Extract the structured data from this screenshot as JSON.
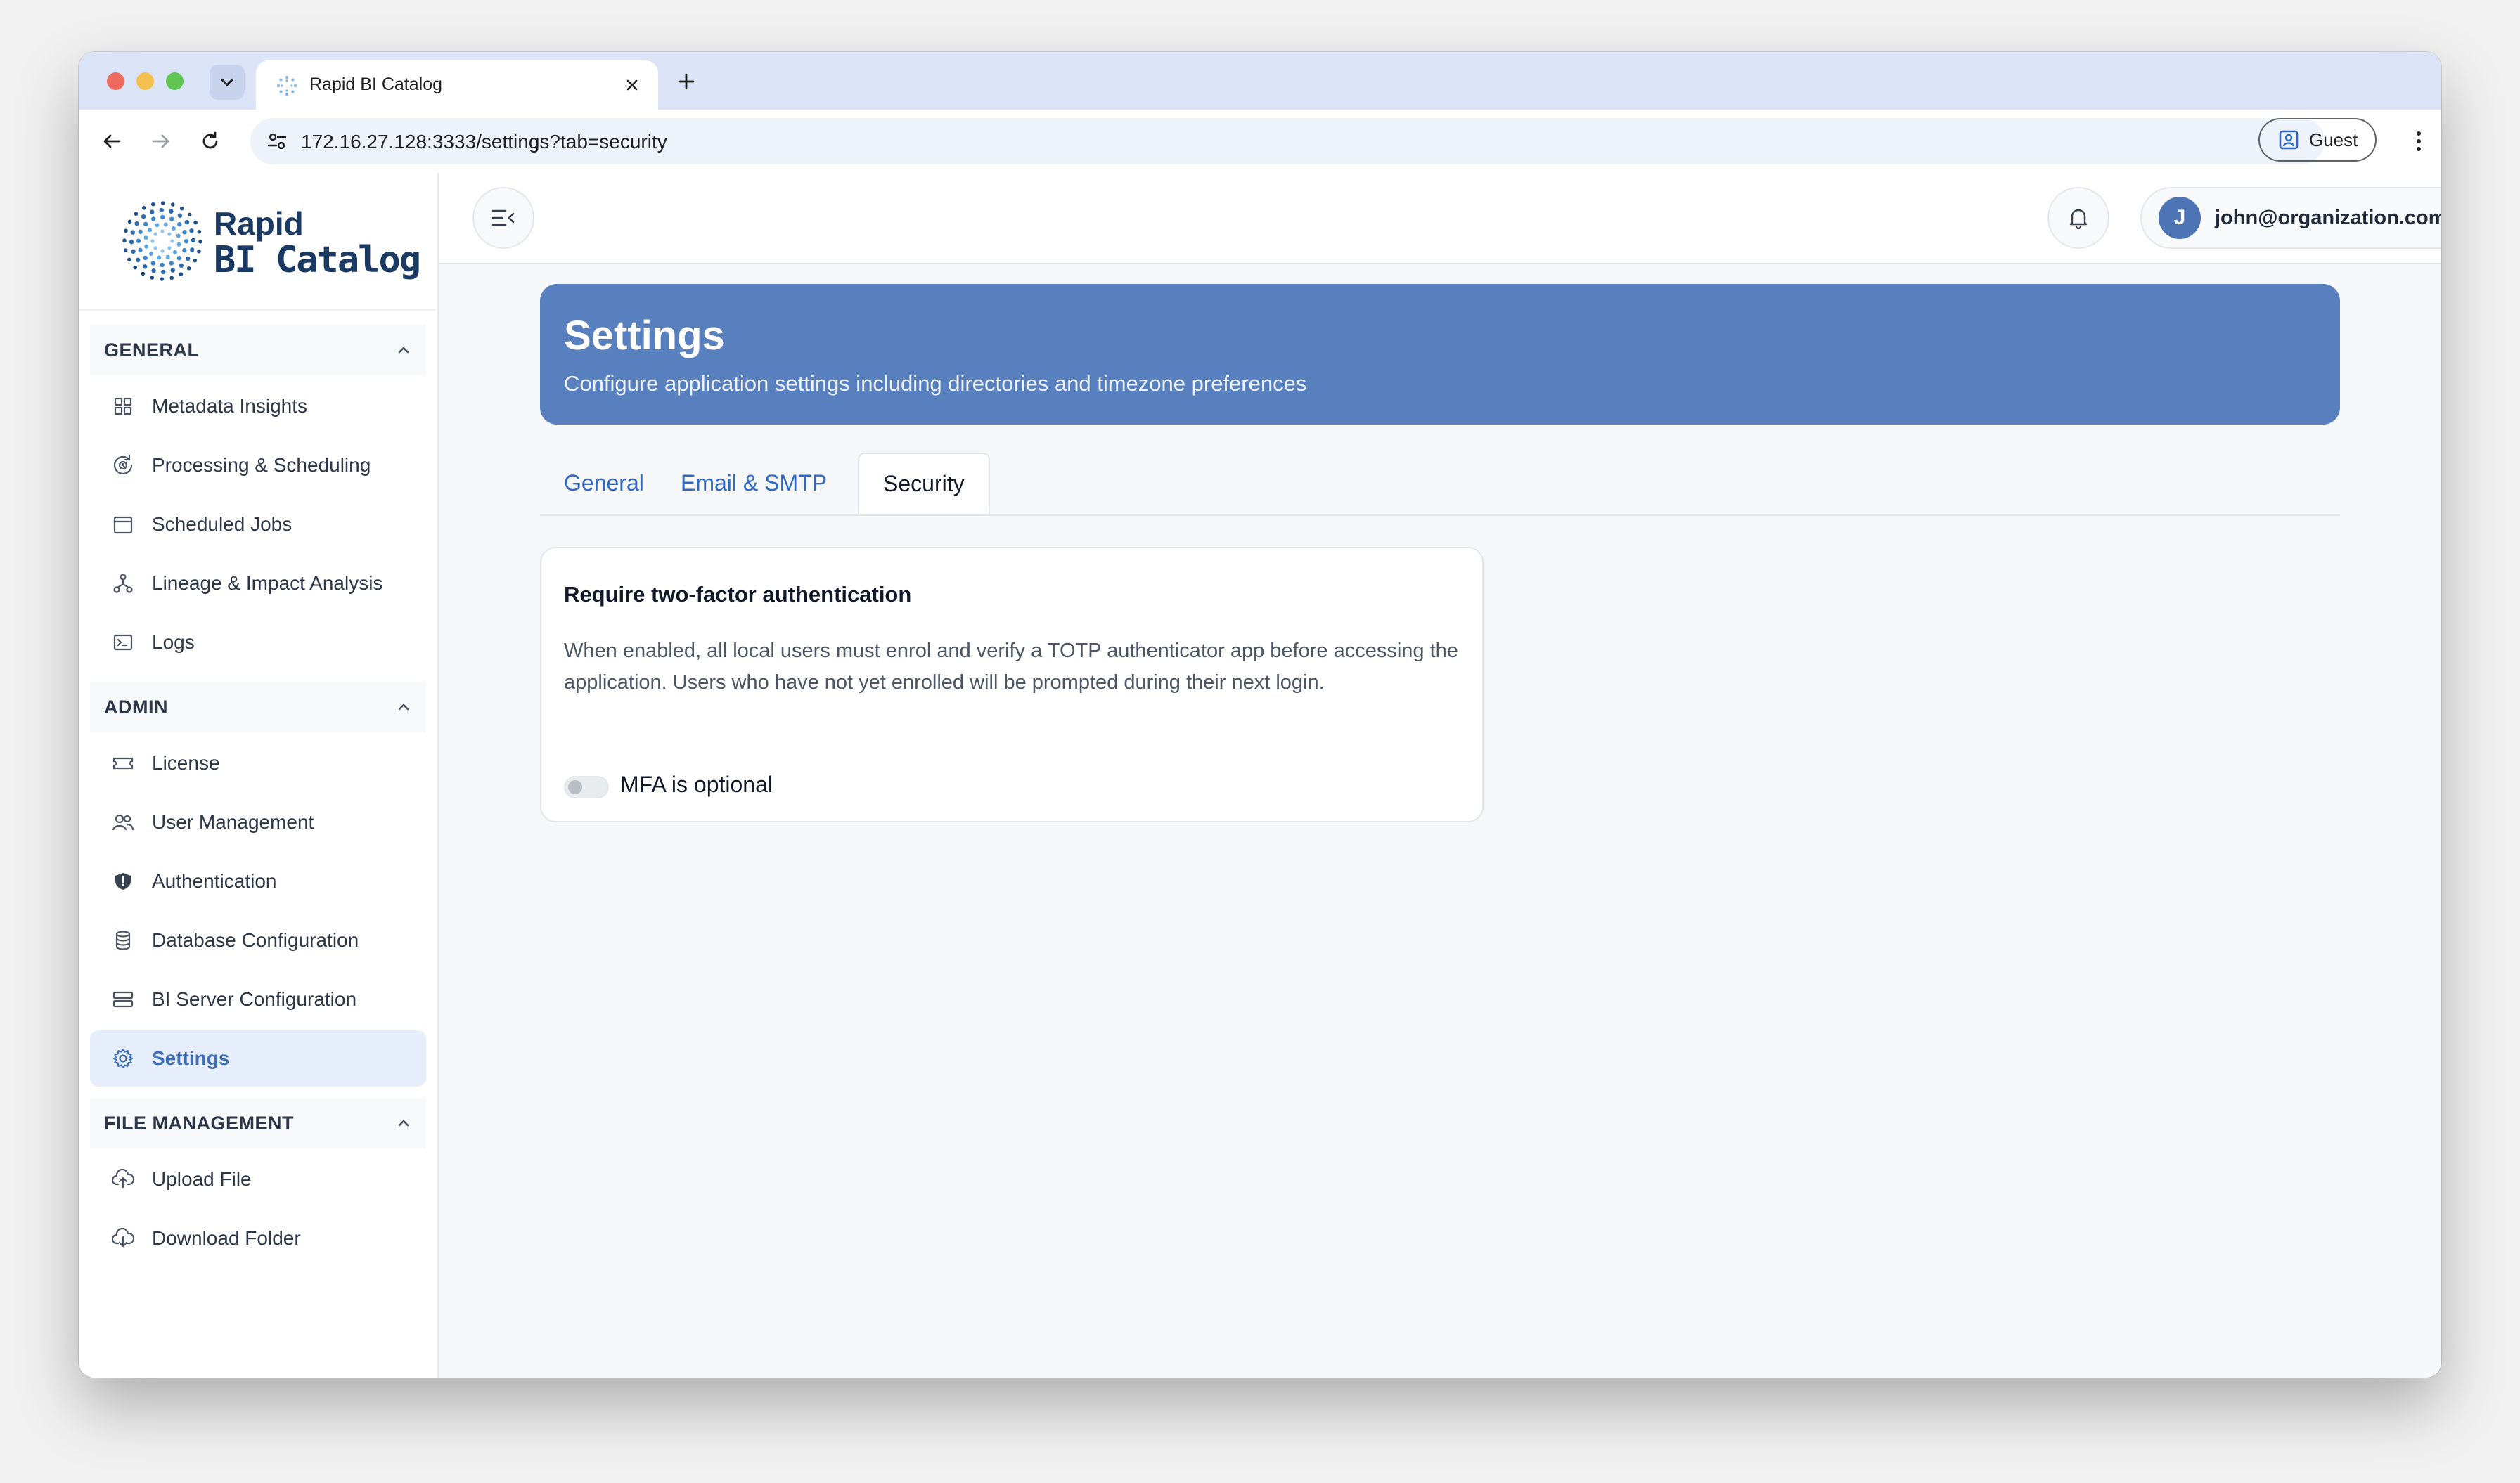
{
  "browser": {
    "tab_title": "Rapid BI Catalog",
    "url": "172.16.27.128:3333/settings?tab=security",
    "profile_label": "Guest"
  },
  "logo": {
    "line1": "Rapid",
    "line2": "BI Catalog"
  },
  "sidebar": {
    "sections": [
      {
        "title": "GENERAL",
        "items": [
          {
            "label": "Metadata Insights",
            "icon": "grid-icon"
          },
          {
            "label": "Processing & Scheduling",
            "icon": "refresh-clock-icon"
          },
          {
            "label": "Scheduled Jobs",
            "icon": "calendar-icon"
          },
          {
            "label": "Lineage & Impact Analysis",
            "icon": "lineage-icon"
          },
          {
            "label": "Logs",
            "icon": "terminal-icon"
          }
        ]
      },
      {
        "title": "ADMIN",
        "items": [
          {
            "label": "License",
            "icon": "ticket-icon"
          },
          {
            "label": "User Management",
            "icon": "users-icon"
          },
          {
            "label": "Authentication",
            "icon": "shield-icon"
          },
          {
            "label": "Database Configuration",
            "icon": "database-icon"
          },
          {
            "label": "BI Server Configuration",
            "icon": "server-icon"
          },
          {
            "label": "Settings",
            "icon": "gear-icon",
            "active": true
          }
        ]
      },
      {
        "title": "FILE MANAGEMENT",
        "items": [
          {
            "label": "Upload File",
            "icon": "cloud-upload-icon"
          },
          {
            "label": "Download Folder",
            "icon": "cloud-download-icon"
          }
        ]
      }
    ]
  },
  "header": {
    "avatar_initial": "J",
    "user_email": "john@organization.com"
  },
  "page": {
    "title": "Settings",
    "subtitle": "Configure application settings including directories and timezone preferences",
    "tabs": [
      {
        "label": "General",
        "active": false
      },
      {
        "label": "Email & SMTP",
        "active": false
      },
      {
        "label": "Security",
        "active": true
      }
    ]
  },
  "security_card": {
    "title": "Require two-factor authentication",
    "description": "When enabled, all local users must enrol and verify a TOTP authenticator app before accessing the application. Users who have not yet enrolled will be prompted during their next login.",
    "toggle_label": "MFA is optional",
    "toggle_on": false
  },
  "colors": {
    "accent": "#5880be",
    "link": "#2f69c4",
    "active_bg": "#e6eefb",
    "brand_text": "#1b3a63"
  }
}
